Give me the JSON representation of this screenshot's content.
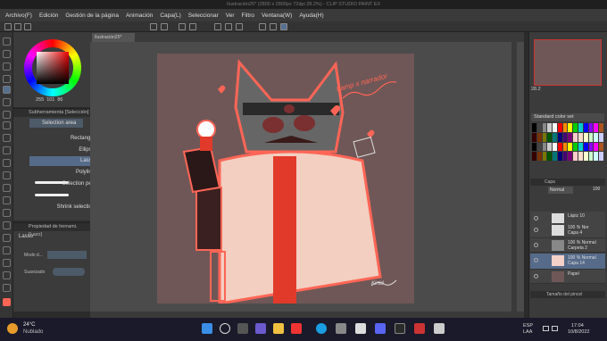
{
  "window": {
    "title": "Ilustración25* (2800 x 2800px 72dpi 28.2%) - CLIP STUDIO PAINT EX"
  },
  "menu": [
    "Archivo(F)",
    "Edición",
    "Gestión de la página",
    "Animación",
    "Capa(L)",
    "Seleccionar",
    "Ver",
    "Filtro",
    "Ventana(W)",
    "Ayuda(H)"
  ],
  "doc_tab": "Ilustración25*",
  "color": {
    "r": "255",
    "g": "101",
    "b": "86",
    "current_hex": "#ff6556"
  },
  "subtool": {
    "header": "Subherramienta [Selección]",
    "group": "Selection area",
    "items": [
      "Rectangle",
      "Ellipse",
      "Lasso",
      "Polyline",
      "Selection peri",
      "Shrink selection"
    ],
    "selected": "Lasso"
  },
  "toolprop": {
    "header": "Propiedad de herrami. [Lazo]",
    "name": "Lasso",
    "mode_label": "Modo d...",
    "smooth_label": "Suavizado"
  },
  "canvas_text": {
    "title_scribble": "Lamp x narrador",
    "sign": "Kirtid"
  },
  "right": {
    "zoom": "28.2",
    "colorset": "Standard color set"
  },
  "layers": {
    "header": "Capa",
    "mode": "Normal",
    "opacity": "100",
    "items": [
      {
        "l1": "Lápiz 10",
        "l2": ""
      },
      {
        "l1": "100 % Nor",
        "l2": "Capa 4"
      },
      {
        "l1": "100 % Normal",
        "l2": "Carpeta 2"
      },
      {
        "l1": "100 % Normal",
        "l2": "Capa 14",
        "selected": true
      },
      {
        "l1": "Papel",
        "l2": ""
      }
    ]
  },
  "bottom_right": {
    "label": "Tamaño del pincel"
  },
  "taskbar": {
    "temp": "24°C",
    "condition": "Nublado",
    "lang": "ESP",
    "lang2": "LAA",
    "time": "17:04",
    "date": "10/8/2022"
  }
}
